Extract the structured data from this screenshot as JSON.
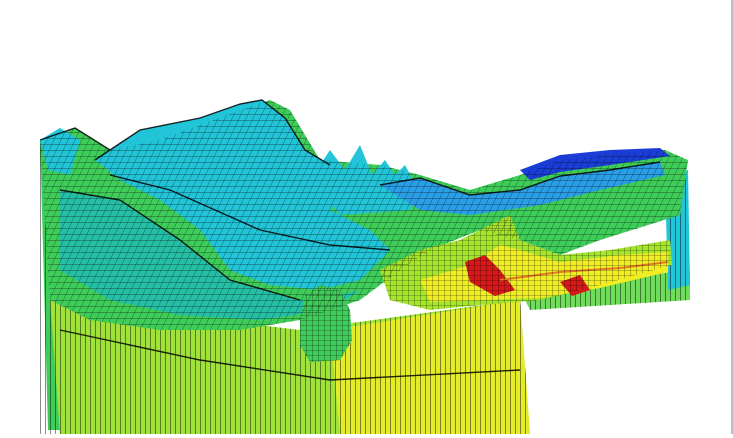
{
  "view": {
    "background": "#ffffff",
    "frame_edge": "#bdbdbd",
    "mesh_line": "#000000"
  },
  "palette": {
    "blue": "#1a3dd6",
    "sky": "#2a9ee6",
    "cyan": "#22c4d8",
    "teal": "#25bfa6",
    "green": "#3fcd5a",
    "lime": "#a6e62a",
    "yellow": "#f0ee22",
    "red": "#d81818",
    "rim": "#000000"
  }
}
